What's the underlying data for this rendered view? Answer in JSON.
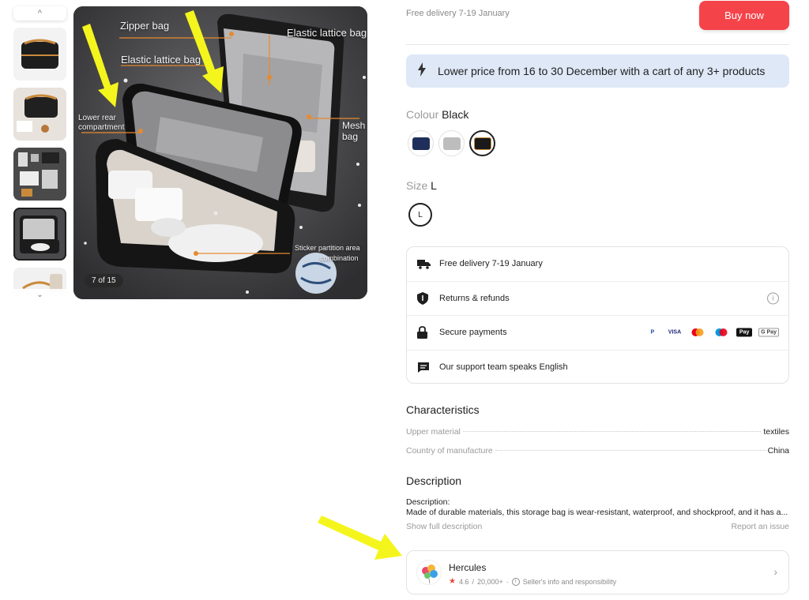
{
  "gallery": {
    "counter": "7 of 15",
    "labels": {
      "zipper_bag": "Zipper bag",
      "elastic_lattice_bag_left": "Elastic lattice bag",
      "elastic_lattice_bag_right": "Elastic lattice bag",
      "lower_rear_line1": "Lower rear",
      "lower_rear_line2": "compartment",
      "mesh_line1": "Mesh",
      "mesh_line2": "bag",
      "sticker_line1": "Sticker partition area",
      "sticker_line2": "combination"
    }
  },
  "header": {
    "delivery_text": "Free delivery 7-19 January",
    "buy_label": "Buy now"
  },
  "promo": {
    "text": "Lower price from 16 to 30 December with a cart of any 3+ products"
  },
  "colour": {
    "label": "Colour",
    "value": "Black",
    "swatches": [
      "navy",
      "grey",
      "black"
    ],
    "selected": "black"
  },
  "size": {
    "label": "Size",
    "value": "L",
    "chip": "L"
  },
  "info": {
    "delivery": "Free delivery 7-19 January",
    "returns": "Returns & refunds",
    "payments": "Secure payments",
    "support": "Our support team speaks English",
    "payment_methods": [
      "PayPal",
      "VISA",
      "Mastercard",
      "Maestro",
      "Apple Pay",
      "G Pay"
    ]
  },
  "characteristics": {
    "title": "Characteristics",
    "rows": [
      {
        "key": "Upper material",
        "value": "textiles"
      },
      {
        "key": "Country of manufacture",
        "value": "China"
      }
    ]
  },
  "description": {
    "title": "Description",
    "label": "Description:",
    "text": "Made of durable materials, this storage bag is wear-resistant, waterproof, and shockproof, and it has a...",
    "show_full": "Show full description",
    "report": "Report an issue"
  },
  "seller": {
    "name": "Hercules",
    "rating": "4.6",
    "orders": "20,000+",
    "info_link": "Seller's info and responsibility"
  },
  "colors": {
    "accent": "#f5434a",
    "promo_bg": "#dfe8f7",
    "annotation": "#f5f51e"
  }
}
